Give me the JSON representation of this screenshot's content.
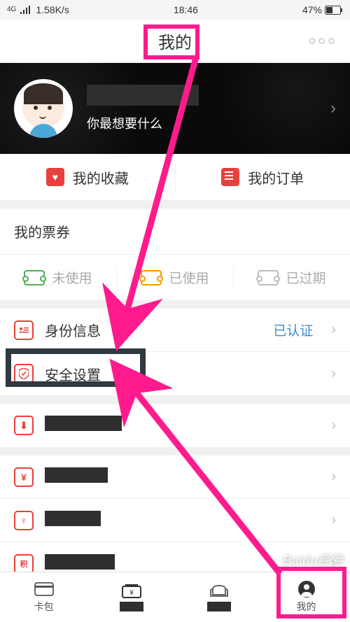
{
  "status": {
    "net": "4G",
    "speed": "1.58K/s",
    "time": "18:46",
    "battery": "47%"
  },
  "header": {
    "title": "我的",
    "more": "○○○"
  },
  "profile": {
    "subtitle": "你最想要什么"
  },
  "row2": {
    "fav": "我的收藏",
    "order": "我的订单"
  },
  "tickets": {
    "title": "我的票券",
    "unused": "未使用",
    "used": "已使用",
    "expired": "已过期"
  },
  "list": {
    "identity": {
      "label": "身份信息",
      "value": "已认证"
    },
    "security": {
      "label": "安全设置"
    }
  },
  "nav": {
    "card": "卡包",
    "mine": "我的"
  },
  "watermark": "Baidu经验"
}
